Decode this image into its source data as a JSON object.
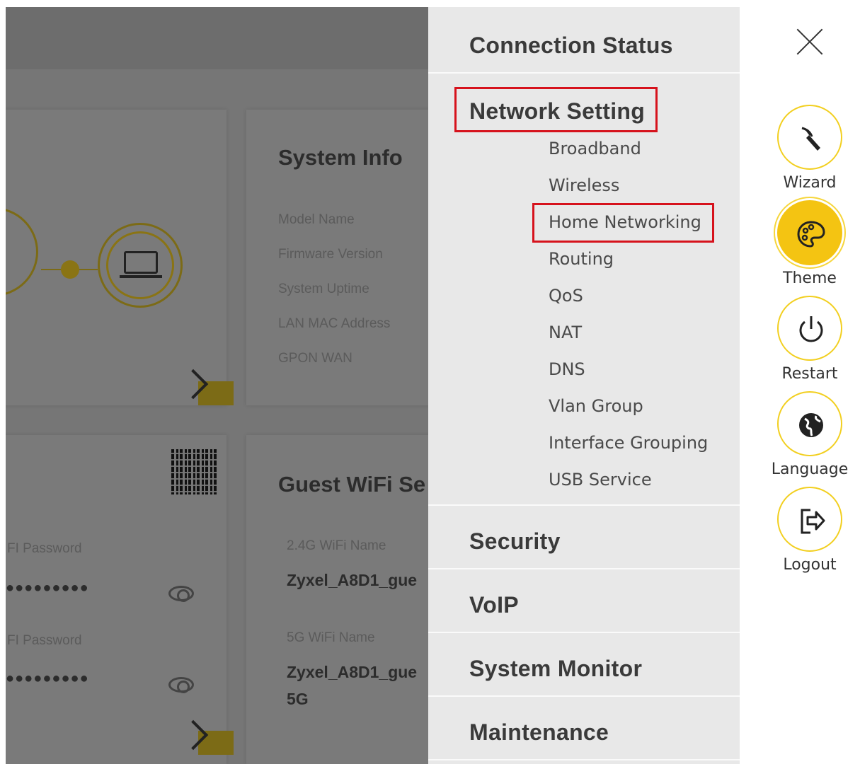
{
  "menu": {
    "sections": [
      {
        "label": "Connection Status"
      },
      {
        "label": "Network Setting"
      },
      {
        "label": "Security"
      },
      {
        "label": "VoIP"
      },
      {
        "label": "System Monitor"
      },
      {
        "label": "Maintenance"
      }
    ],
    "network_setting_items": [
      {
        "label": "Broadband"
      },
      {
        "label": "Wireless"
      },
      {
        "label": "Home Networking"
      },
      {
        "label": "Routing"
      },
      {
        "label": "QoS"
      },
      {
        "label": "NAT"
      },
      {
        "label": "DNS"
      },
      {
        "label": "Vlan Group"
      },
      {
        "label": "Interface Grouping"
      },
      {
        "label": "USB Service"
      }
    ],
    "highlighted": [
      "Network Setting",
      "Home Networking"
    ],
    "highlight_color": "#d6121c"
  },
  "sidebar": {
    "close_icon": "close-icon",
    "buttons": [
      {
        "label": "Wizard",
        "icon": "wand-icon"
      },
      {
        "label": "Theme",
        "icon": "palette-icon",
        "active": true
      },
      {
        "label": "Restart",
        "icon": "power-icon"
      },
      {
        "label": "Language",
        "icon": "globe-icon"
      },
      {
        "label": "Logout",
        "icon": "logout-icon"
      }
    ],
    "accent_color": "#f4c412"
  },
  "dashboard": {
    "system_info": {
      "title": "System Info",
      "labels": [
        "Model Name",
        "Firmware Version",
        "System Uptime",
        "LAN MAC Address",
        "GPON WAN"
      ]
    },
    "wifi": {
      "password_label_1": "FI Password",
      "password_value_1": "●●●●●●●●●",
      "password_label_2": "FI Password",
      "password_value_2": "●●●●●●●●●"
    },
    "guest_wifi": {
      "title": "Guest WiFi Se",
      "name_24_label": "2.4G WiFi Name",
      "name_24_value": "Zyxel_A8D1_gue",
      "name_5_label": "5G WiFi Name",
      "name_5_value": "Zyxel_A8D1_gue",
      "name_5_value_cont": "5G"
    }
  }
}
